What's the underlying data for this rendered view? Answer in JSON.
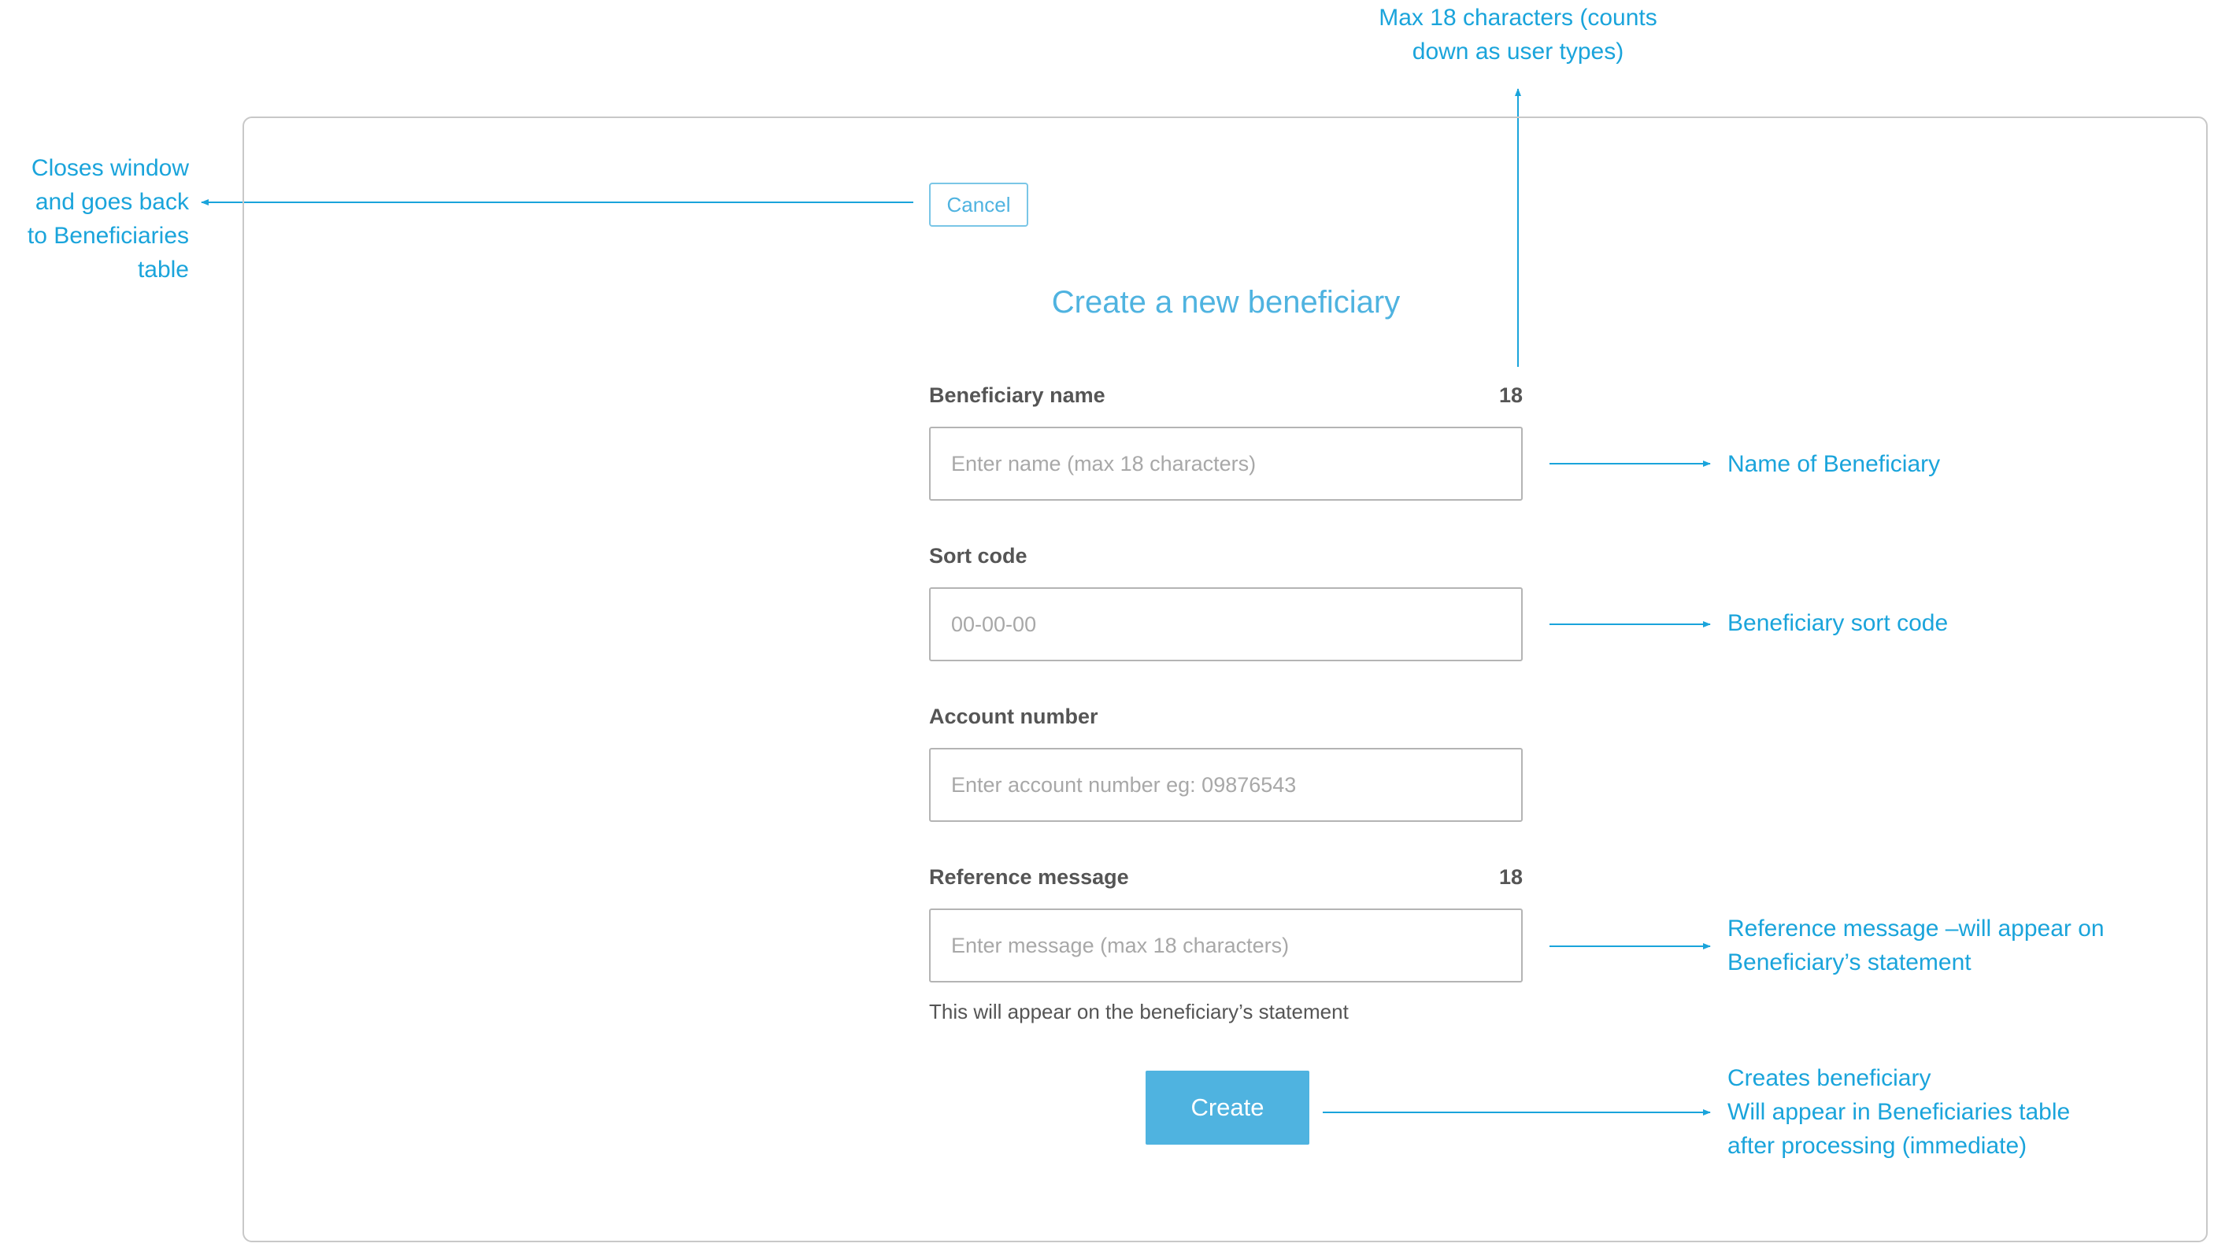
{
  "dialog": {
    "cancel_label": "Cancel",
    "title": "Create a new beneficiary",
    "fields": {
      "beneficiary_name": {
        "label": "Beneficiary name",
        "counter": "18",
        "value": "",
        "placeholder": "Enter name (max 18 characters)"
      },
      "sort_code": {
        "label": "Sort code",
        "value": "",
        "placeholder": "00-00-00"
      },
      "account_number": {
        "label": "Account number",
        "value": "",
        "placeholder": "Enter account number eg: 09876543"
      },
      "reference_message": {
        "label": "Reference message",
        "counter": "18",
        "value": "",
        "placeholder": "Enter message (max 18 characters)",
        "helper": "This will appear on the beneficiary’s statement"
      }
    },
    "create_label": "Create"
  },
  "annotations": {
    "cancel_note": [
      "Closes window",
      "and goes back",
      "to Beneficiaries",
      "table"
    ],
    "counter_note": [
      "Max 18 characters (counts",
      "down as user types)"
    ],
    "name_note": [
      "Name of Beneficiary"
    ],
    "sort_code_note": [
      "Beneficiary sort code"
    ],
    "reference_note": [
      "Reference message –will appear on",
      "Beneficiary’s statement"
    ],
    "create_note": [
      "Creates beneficiary",
      "Will appear in Beneficiaries table",
      "after processing (immediate)"
    ]
  },
  "colors": {
    "accent": "#4fb3e0",
    "annotation": "#1aa4db",
    "border": "#b4b4b4",
    "frame": "#c8c8c8"
  }
}
